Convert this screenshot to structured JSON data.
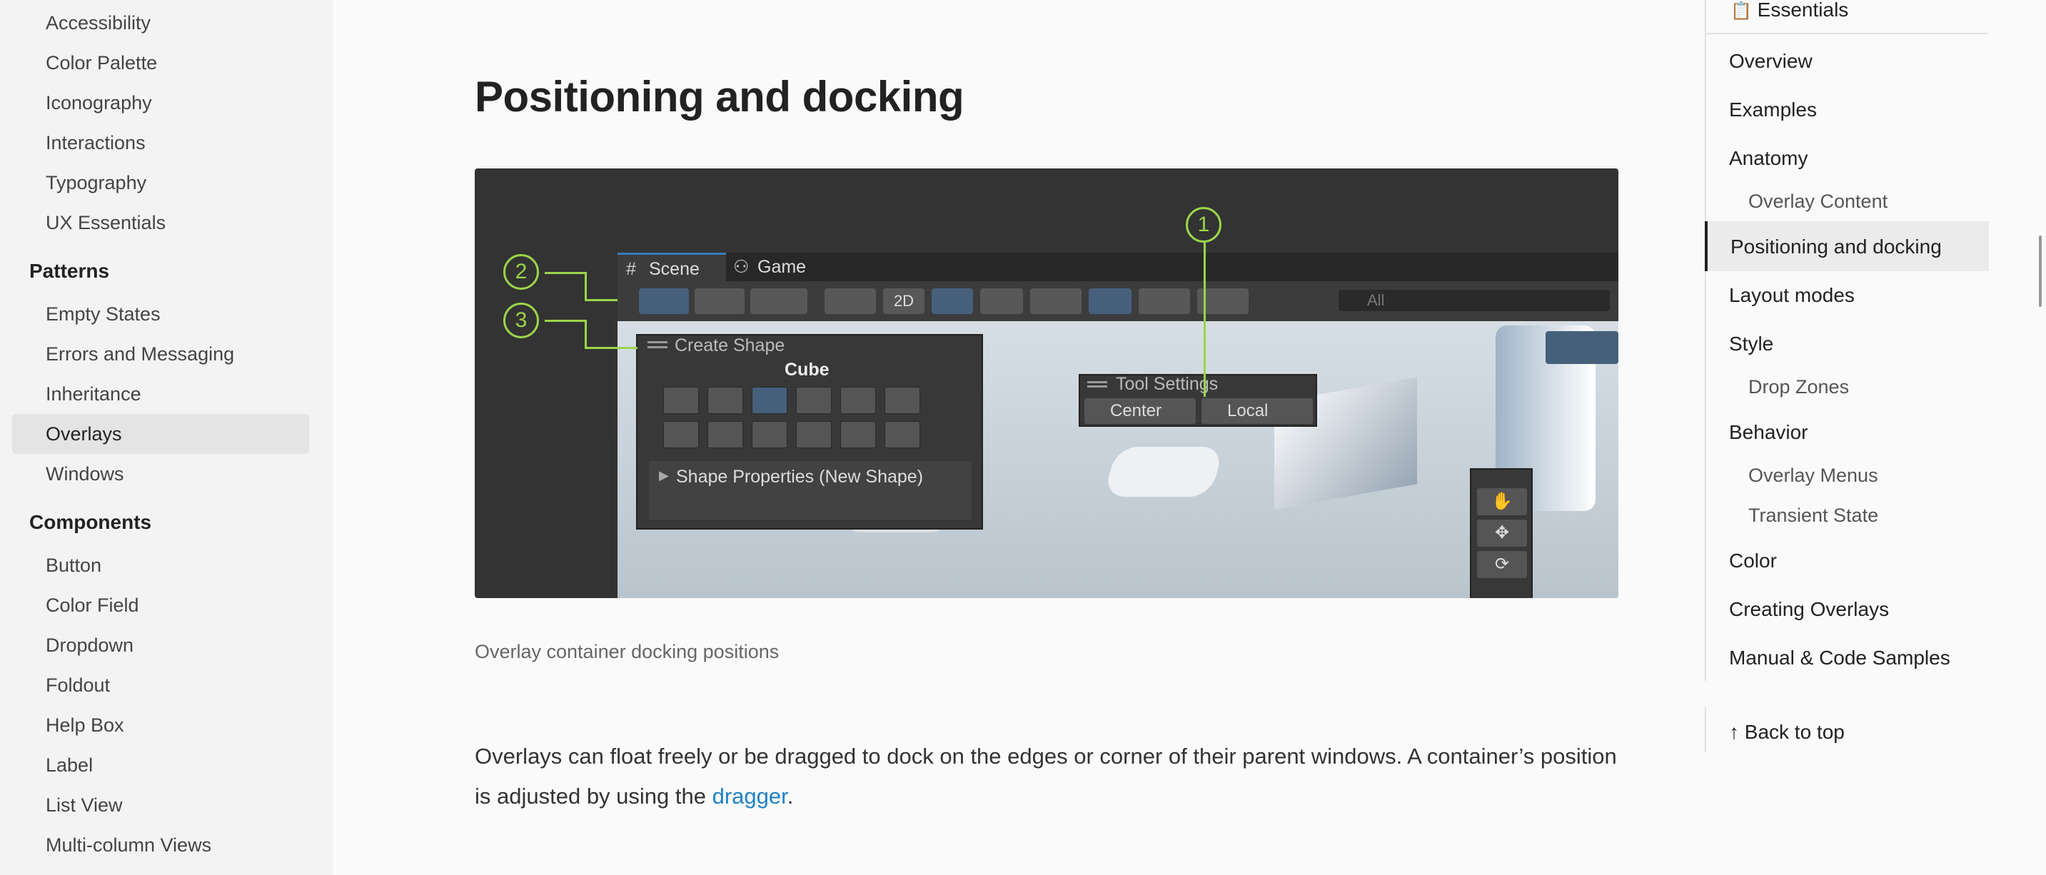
{
  "sidebar": {
    "items_top": [
      "Accessibility",
      "Color Palette",
      "Iconography",
      "Interactions",
      "Typography",
      "UX Essentials"
    ],
    "patterns_heading": "Patterns",
    "patterns": [
      "Empty States",
      "Errors and Messaging",
      "Inheritance",
      "Overlays",
      "Windows"
    ],
    "components_heading": "Components",
    "components": [
      "Button",
      "Color Field",
      "Dropdown",
      "Foldout",
      "Help Box",
      "Label",
      "List View",
      "Multi-column Views"
    ]
  },
  "main": {
    "title": "Positioning and docking",
    "caption": "Overlay container docking positions",
    "paragraph_before": "Overlays can float freely or be dragged to dock on the edges or corner of their parent windows. A container’s position is adjusted by using the ",
    "link": "dragger",
    "paragraph_after": "."
  },
  "figure": {
    "tab_scene": "Scene",
    "tab_game": "Game",
    "toolbar_2d": "2D",
    "search_placeholder": "All",
    "create_shape_title": "Create Shape",
    "cube_label": "Cube",
    "shape_properties": "Shape Properties (New Shape)",
    "tool_settings_title": "Tool Settings",
    "center_label": "Center",
    "local_label": "Local",
    "callouts": [
      "1",
      "2",
      "3"
    ]
  },
  "toc": {
    "essentials": "Essentials",
    "items": [
      "Overview",
      "Examples",
      "Anatomy",
      "Overlay Content",
      "Positioning and docking",
      "Layout modes",
      "Style",
      "Drop Zones",
      "Behavior",
      "Overlay Menus",
      "Transient State",
      "Color",
      "Creating Overlays",
      "Manual & Code Samples"
    ],
    "back_to_top": "↑ Back to top"
  },
  "colors": {
    "accent": "#1f82c5",
    "callout": "#9bd44a"
  }
}
